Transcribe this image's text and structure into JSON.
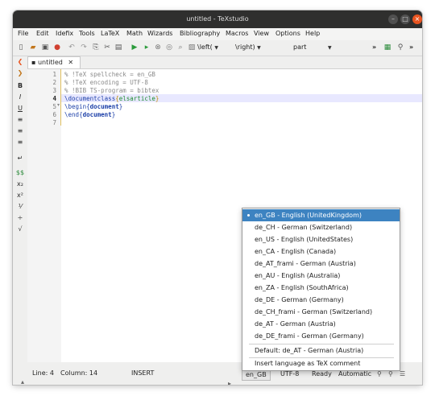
{
  "window": {
    "title": "untitled - TeXstudio"
  },
  "menu": [
    "File",
    "Edit",
    "Idefix",
    "Tools",
    "LaTeX",
    "Math",
    "Wizards",
    "Bibliography",
    "Macros",
    "View",
    "Options",
    "Help"
  ],
  "toolbar": {
    "left_label": "\\left(",
    "right_label": "\\right)",
    "part_label": "part",
    "overflow": "»"
  },
  "tab": {
    "label": "untitled"
  },
  "editor": {
    "line_numbers": [
      "1",
      "2",
      "3",
      "4",
      "5",
      "6",
      "7"
    ],
    "lines": {
      "l1": "% !TeX spellcheck = en_GB",
      "l2": "% !TeX encoding = UTF-8",
      "l3": "% !BIB TS-program = bibtex",
      "l4_cmd": "\\documentclass",
      "l4_open": "{",
      "l4_arg": "elsarticle",
      "l4_close": "}",
      "l5_cmd": "\\begin",
      "l5_open": "{",
      "l5_arg": "document",
      "l5_close": "}",
      "l6_cmd": "\\end",
      "l6_open": "{",
      "l6_arg": "document",
      "l6_close": "}"
    }
  },
  "status": {
    "line": "Line: 4",
    "column": "Column: 14",
    "mode": "INSERT",
    "language": "en_GB",
    "encoding": "UTF-8",
    "state": "Ready",
    "compile_mode": "Automatic"
  },
  "language_menu": {
    "items": [
      "en_GB - English (UnitedKingdom)",
      "de_CH - German (Switzerland)",
      "en_US - English (UnitedStates)",
      "en_CA - English (Canada)",
      "de_AT_frami - German (Austria)",
      "en_AU - English (Australia)",
      "en_ZA - English (SouthAfrica)",
      "de_DE - German (Germany)",
      "de_CH_frami - German (Switzerland)",
      "de_AT - German (Austria)",
      "de_DE_frami - German (Germany)"
    ],
    "default": "Default: de_AT - German (Austria)",
    "insert_comment": "Insert language as TeX comment"
  },
  "colors": {
    "accent": "#3d83c1",
    "titlebar": "#2f2f2e",
    "close": "#e95420"
  }
}
